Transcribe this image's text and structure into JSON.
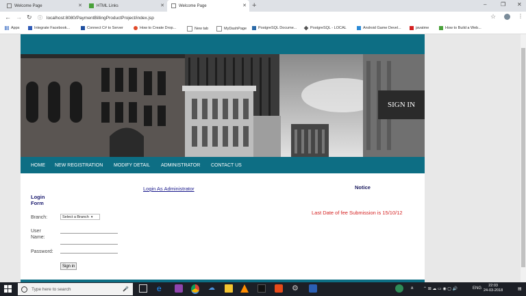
{
  "browser": {
    "tabs": [
      {
        "title": "Welcome Page",
        "active": false
      },
      {
        "title": "HTML Links",
        "active": false
      },
      {
        "title": "Welcome Page",
        "active": true
      }
    ],
    "new_tab": "+",
    "url": "localhost:8080/PaymentBillingProductProject/index.jsp"
  },
  "bookmarks": [
    {
      "label": "Apps",
      "color": "#4a78c8"
    },
    {
      "label": "Integrate Facebook...",
      "color": "#2f5bb7"
    },
    {
      "label": "Connect C# to Server",
      "color": "#1e4fa0"
    },
    {
      "label": "How to Create Drop...",
      "color": "#e04a2a"
    },
    {
      "label": "New tab",
      "color": "#888888"
    },
    {
      "label": "MyDashPage",
      "color": "#888888"
    },
    {
      "label": "PostgreSQL Docume...",
      "color": "#2b6aa8"
    },
    {
      "label": "PostgreSQL - LOCAL",
      "color": "#555555"
    },
    {
      "label": "Android Game Devel...",
      "color": "#2b8ad6"
    },
    {
      "label": "javatme",
      "color": "#d42020"
    },
    {
      "label": "How to Build a Web...",
      "color": "#49a13a"
    }
  ],
  "site": {
    "hero_signin": "SIGN IN",
    "nav": [
      "HOME",
      "NEW REGISTRATION",
      "MODIFY DETAIL",
      "ADMINISTRATOR",
      "CONTACT US"
    ],
    "admin_link": "Login As Administrator",
    "notice_title": "Notice",
    "notice_text": "Last Date of fee Submission is 15/10/12",
    "form": {
      "title_line1": "Login",
      "title_line2": "Form",
      "branch_label": "Branch:",
      "branch_selected": "Select a Branch",
      "username_label_line1": "User",
      "username_label_line2": "Name:",
      "username_value": "",
      "password_label": "Password:",
      "password_value": "",
      "submit_label": "Sign in"
    }
  },
  "taskbar": {
    "search_placeholder": "Type here to search",
    "language": "ENG",
    "time": "22:03",
    "date": "24-03-2018"
  },
  "colors": {
    "teal": "#0d6e84",
    "notice_red": "#d42020"
  }
}
